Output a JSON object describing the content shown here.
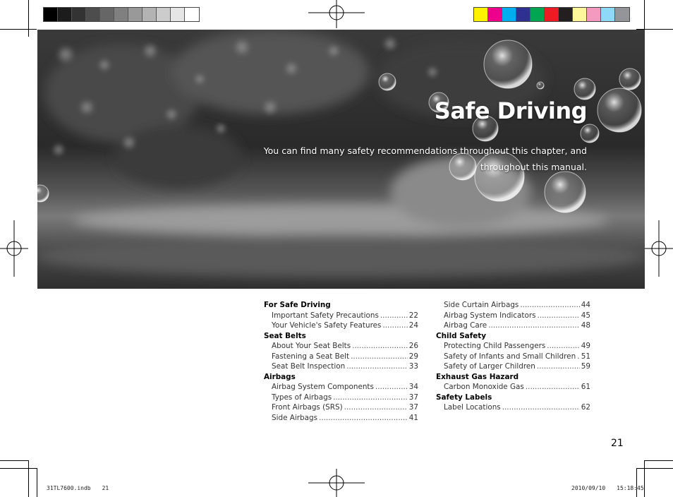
{
  "calibration": {
    "gray_swatches": [
      "#000000",
      "#1c1c1c",
      "#333333",
      "#4d4d4d",
      "#666666",
      "#808080",
      "#999999",
      "#b3b3b3",
      "#cccccc",
      "#e6e6e6",
      "#ffffff"
    ],
    "color_swatches": [
      "#fff200",
      "#ec008c",
      "#00aeef",
      "#2e3192",
      "#00a651",
      "#ed1c24",
      "#231f20",
      "#fff799",
      "#f49ac1",
      "#8ed8f8",
      "#939598"
    ]
  },
  "chapter": {
    "title": "Safe Driving",
    "intro": "You can find many safety recommendations throughout this chapter, and throughout this manual."
  },
  "toc": {
    "left": [
      {
        "section": "For Safe Driving",
        "entries": [
          {
            "title": "Important Safety Precautions",
            "page": "22"
          },
          {
            "title": "Your Vehicle's Safety Features",
            "page": "24"
          }
        ]
      },
      {
        "section": "Seat Belts",
        "entries": [
          {
            "title": "About Your Seat Belts",
            "page": "26"
          },
          {
            "title": "Fastening a Seat Belt",
            "page": "29"
          },
          {
            "title": "Seat Belt Inspection",
            "page": "33"
          }
        ]
      },
      {
        "section": "Airbags",
        "entries": [
          {
            "title": "Airbag System Components",
            "page": "34"
          },
          {
            "title": "Types of Airbags",
            "page": "37"
          },
          {
            "title": "Front Airbags (SRS)",
            "page": "37"
          },
          {
            "title": "Side Airbags",
            "page": "41"
          }
        ]
      }
    ],
    "right": [
      {
        "section": "",
        "entries": [
          {
            "title": "Side Curtain Airbags",
            "page": "44"
          },
          {
            "title": "Airbag System Indicators",
            "page": "45"
          },
          {
            "title": "Airbag Care",
            "page": "48"
          }
        ]
      },
      {
        "section": "Child Safety",
        "entries": [
          {
            "title": "Protecting Child Passengers",
            "page": "49"
          },
          {
            "title": "Safety of Infants and Small Children",
            "page": "51"
          },
          {
            "title": "Safety of Larger Children",
            "page": "59"
          }
        ]
      },
      {
        "section": "Exhaust Gas Hazard",
        "entries": [
          {
            "title": "Carbon Monoxide Gas",
            "page": "61"
          }
        ]
      },
      {
        "section": "Safety Labels",
        "entries": [
          {
            "title": "Label Locations",
            "page": "62"
          }
        ]
      }
    ]
  },
  "page_number": "21",
  "slug": {
    "file": "31TL7600.indb　　21",
    "timestamp": "2010/09/10　　15:18:45"
  }
}
